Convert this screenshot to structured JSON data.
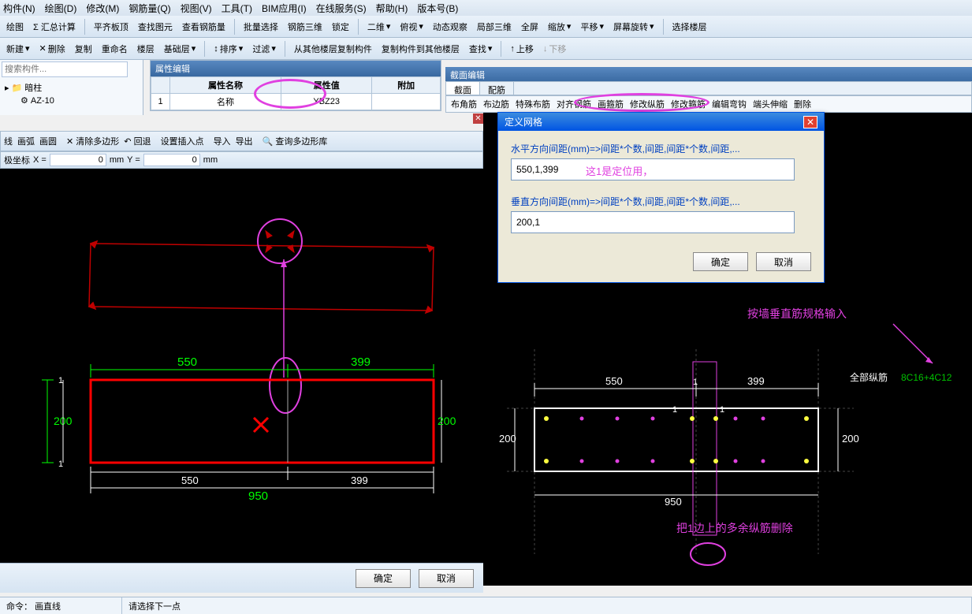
{
  "menu": {
    "items": [
      "构件(N)",
      "绘图(D)",
      "修改(M)",
      "钢筋量(Q)",
      "视图(V)",
      "工具(T)",
      "BIM应用(I)",
      "在线服务(S)",
      "帮助(H)",
      "版本号(B)"
    ]
  },
  "tb1": {
    "draw": "绘图",
    "sum": "Σ 汇总计算",
    "level": "平齐板顶",
    "find": "查找图元",
    "rebar": "查看钢筋量",
    "msel": "批量选择",
    "r3d": "钢筋三维",
    "lock": "锁定",
    "d2": "二维",
    "ortho": "俯视",
    "dyn": "动态观察",
    "l3d": "局部三维",
    "full": "全屏",
    "zoom": "缩放",
    "pan": "平移",
    "rot": "屏幕旋转",
    "floor": "选择楼层"
  },
  "tb2": {
    "new": "新建",
    "del": "删除",
    "copy": "复制",
    "rename": "重命名",
    "layer": "楼层",
    "base": "基础层",
    "sort": "排序",
    "filter": "过滤",
    "copyfrom": "从其他楼层复制构件",
    "copyto": "复制构件到其他楼层",
    "findx": "查找",
    "up": "上移",
    "down": "下移"
  },
  "search": {
    "placeholder": "搜索构件..."
  },
  "tree": {
    "root": "暗柱",
    "child": "AZ-10"
  },
  "props": {
    "title": "属性编辑",
    "h_name": "属性名称",
    "h_val": "属性值",
    "h_extra": "附加",
    "row1_idx": "1",
    "row1_name": "名称",
    "row1_val": "YBZ23"
  },
  "section": {
    "title": "截面编辑",
    "tab1": "截面",
    "tab2": "配筋",
    "btns": [
      "布角筋",
      "布边筋",
      "特殊布筋",
      "对齐钢筋",
      "画箍筋",
      "修改纵筋",
      "修改箍筋",
      "编辑弯钩",
      "端头伸缩",
      "删除"
    ]
  },
  "drawtb": {
    "line": "线",
    "arc": "画弧",
    "circle": "画圆",
    "clear": "清除多边形",
    "undo": "回退",
    "ins": "设置插入点",
    "imp": "导入",
    "exp": "导出",
    "qpoly": "查询多边形库"
  },
  "coord": {
    "label": "极坐标",
    "x": "X =",
    "xv": "0",
    "mm": "mm",
    "y": "Y =",
    "yv": "0"
  },
  "dialog": {
    "title": "定义网格",
    "h_label": "水平方向间距(mm)=>间距*个数,间距,间距*个数,间距,...",
    "h_value": "550,1,399",
    "h_note": "这1是定位用，",
    "v_label": "垂直方向间距(mm)=>间距*个数,间距,间距*个数,间距,...",
    "v_value": "200,1",
    "ok": "确定",
    "cancel": "取消"
  },
  "btns": {
    "ok": "确定",
    "cancel": "取消"
  },
  "status": {
    "cmd_lbl": "命令：",
    "cmd": "画直线",
    "hint": "请选择下一点"
  },
  "annot": {
    "r_top": "按墙垂直筋规格输入",
    "r_label": "全部纵筋",
    "r_spec": "8C16+4C12",
    "r_bottom": "把1边上的多余纵筋删除"
  },
  "dims": {
    "d550": "550",
    "d399": "399",
    "d200": "200",
    "d950": "950",
    "d1": "1"
  }
}
